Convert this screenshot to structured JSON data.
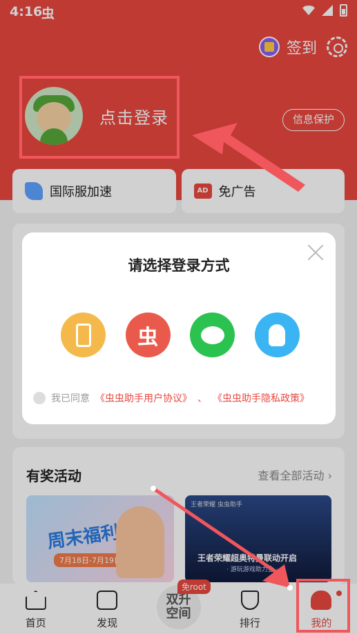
{
  "status_bar": {
    "time": "4:16",
    "app_glyph": "虫"
  },
  "topbar": {
    "signin_label": "签到"
  },
  "profile": {
    "login_label": "点击登录",
    "privacy_button": "信息保护"
  },
  "features": [
    {
      "label": "国际服加速",
      "icon": "rocket-icon"
    },
    {
      "label": "免广告",
      "icon": "no-ads-icon",
      "icon_text": "AD"
    }
  ],
  "dialog": {
    "title": "请选择登录方式",
    "methods": [
      {
        "name": "phone",
        "icon": "phone-icon",
        "color": "#f4b94a"
      },
      {
        "name": "chongchong",
        "icon": "chongchong-logo-icon",
        "glyph": "虫",
        "color": "#ea5a4c"
      },
      {
        "name": "wechat",
        "icon": "wechat-icon",
        "color": "#2cc24f"
      },
      {
        "name": "qq",
        "icon": "qq-icon",
        "color": "#3ab4f2"
      }
    ],
    "agreement": {
      "prefix": "我已同意",
      "user_agreement": "《虫虫助手用户协议》",
      "separator": "、",
      "privacy_policy": "《虫虫助手隐私政策》"
    }
  },
  "activities": {
    "title": "有奖活动",
    "more": "查看全部活动 ›",
    "banners": [
      {
        "text": "周末福利",
        "date": "7月18日-7月19日"
      },
      {
        "tag": "王者荣耀 虫虫助手",
        "text": "王者荣耀超奥特曼联动开启",
        "sub": "· 游玩游戏助力金 ·"
      }
    ]
  },
  "tabbar": {
    "tabs": [
      {
        "label": "首页"
      },
      {
        "label": "发现"
      },
      {
        "center_line1": "双升",
        "center_line2": "空间",
        "badge": "免root"
      },
      {
        "label": "排行"
      },
      {
        "label": "我的"
      }
    ]
  },
  "colors": {
    "brand_red": "#e8473f",
    "annotation_red": "#f0575c"
  }
}
